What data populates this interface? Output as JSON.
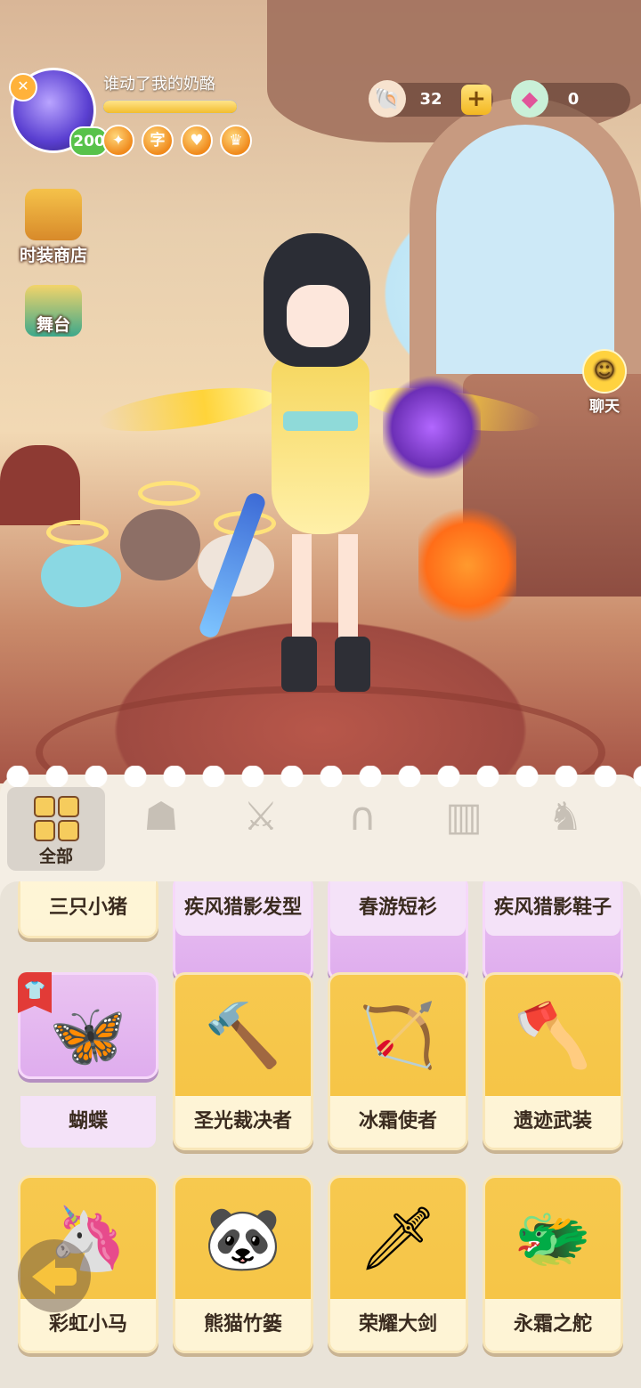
{
  "player": {
    "name": "谁动了我的奶酪",
    "level": "200",
    "exp_fraction": 1.0,
    "medals": [
      "star-medal",
      "word-medal",
      "shield-medal",
      "crown-medal"
    ]
  },
  "currency": [
    {
      "icon": "shell-icon",
      "amount": "32",
      "has_plus": true
    },
    {
      "icon": "gem-icon",
      "amount": "0",
      "has_plus": false
    }
  ],
  "side_buttons": {
    "fashion_shop": "时装商店",
    "stage": "舞台",
    "chat": "聊天"
  },
  "categories": {
    "all_label": "全部",
    "icons": [
      "mask-icon",
      "weapon-icon",
      "hair-icon",
      "clothes-icon",
      "pet-icon",
      "wing-icon"
    ]
  },
  "items": {
    "row1": [
      {
        "label": "三只小猪",
        "style": "yellow"
      },
      {
        "label": "疾风猎影发型",
        "style": "purple"
      },
      {
        "label": "春游短衫",
        "style": "purple"
      },
      {
        "label": "疾风猎影鞋子",
        "style": "purple"
      }
    ],
    "row2": [
      {
        "label": "蝴蝶",
        "style": "purple",
        "art": "butterfly-icon",
        "equipped": true
      },
      {
        "label": "圣光裁决者",
        "style": "yellow",
        "art": "hammer-icon"
      },
      {
        "label": "冰霜使者",
        "style": "yellow",
        "art": "bow-icon"
      },
      {
        "label": "遗迹武装",
        "style": "yellow",
        "art": "axe-icon"
      }
    ],
    "row3": [
      {
        "label": "彩虹小马",
        "style": "yellow",
        "art": "pony-icon"
      },
      {
        "label": "熊猫竹篓",
        "style": "yellow",
        "art": "bamboo-basket-icon"
      },
      {
        "label": "荣耀大剑",
        "style": "yellow",
        "art": "greatsword-icon"
      },
      {
        "label": "永霜之舵",
        "style": "yellow",
        "art": "frost-helm-icon"
      }
    ]
  },
  "colors": {
    "accent_yellow": "#f5c343",
    "accent_purple": "#e3b6ef",
    "badge_green": "#58c24a",
    "ribbon_red": "#e23b37"
  }
}
